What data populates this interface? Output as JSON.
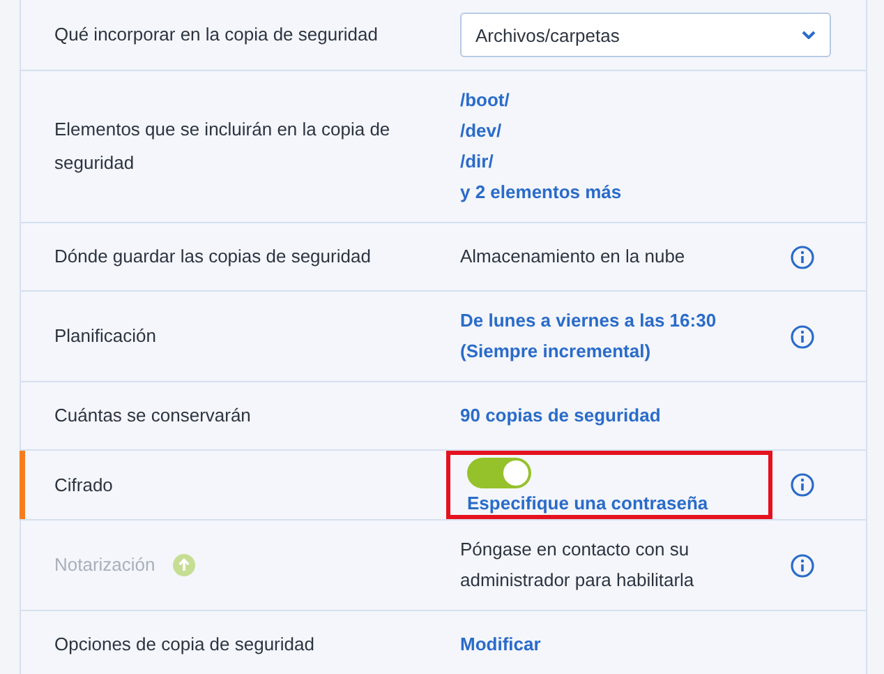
{
  "rows": [
    {
      "kind": "select",
      "label": "Qué incorporar en la copia de seguridad",
      "value": "Archivos/carpetas"
    },
    {
      "kind": "links",
      "label": "Elementos que se incluirán en la copia de seguridad",
      "links": [
        "/boot/",
        "/dev/",
        "/dir/",
        "y 2 elementos más"
      ]
    },
    {
      "kind": "text",
      "label": "Dónde guardar las copias de seguridad",
      "value": "Almacenamiento en la nube",
      "info": true
    },
    {
      "kind": "links",
      "label": "Planificación",
      "links": [
        "De lunes a viernes a las 16:30",
        "(Siempre incremental)"
      ],
      "info": true
    },
    {
      "kind": "links",
      "label": "Cuántas se conservarán",
      "links": [
        "90 copias de seguridad"
      ]
    },
    {
      "kind": "toggle",
      "label": "Cifrado",
      "on": true,
      "link": "Especifique una contraseña",
      "info": true,
      "flagged": true,
      "highlighted": true
    },
    {
      "kind": "text",
      "label": "Notarización",
      "value": "Póngase en contacto con su administrador para habilitarla",
      "info": true,
      "disabled": true
    },
    {
      "kind": "links",
      "label": "Opciones de copia de seguridad",
      "links": [
        "Modificar"
      ]
    }
  ]
}
